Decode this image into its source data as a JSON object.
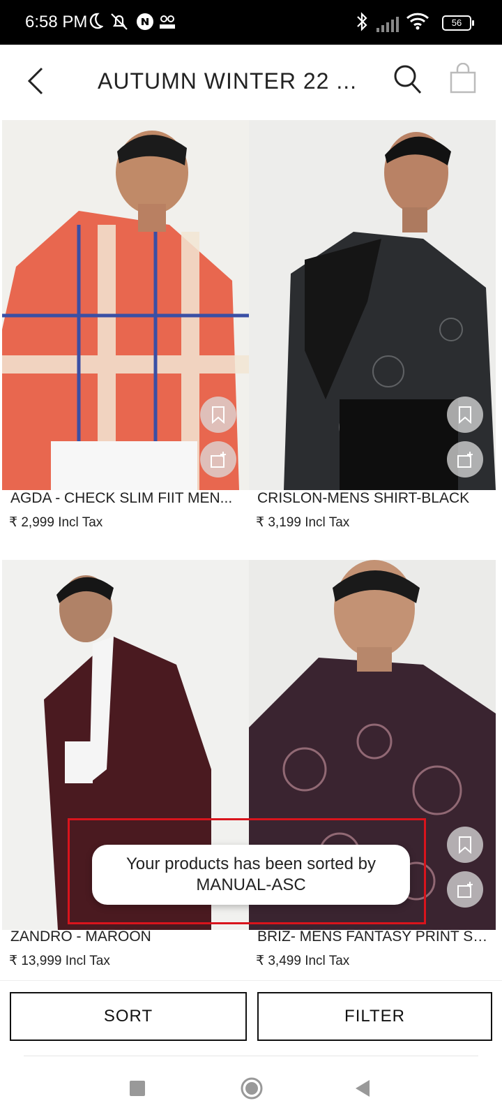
{
  "status_bar": {
    "time": "6:58 PM",
    "battery": "56"
  },
  "header": {
    "title": "AUTUMN WINTER 22 ...",
    "back_icon": "back-arrow-icon",
    "search_icon": "search-icon",
    "bag_icon": "shopping-bag-icon"
  },
  "products": [
    {
      "name": "AGDA - CHECK SLIM FIIT MEN...",
      "price": "₹ 2,999 Incl Tax"
    },
    {
      "name": "CRISLON-MENS SHIRT-BLACK",
      "price": "₹ 3,199 Incl Tax"
    },
    {
      "name": "ZANDRO - MAROON",
      "price": "₹ 13,999 Incl Tax"
    },
    {
      "name": "BRIZ- MENS FANTASY PRINT SH...",
      "price": "₹ 3,499 Incl Tax"
    }
  ],
  "actions": {
    "sort_label": "SORT",
    "filter_label": "FILTER"
  },
  "toast": {
    "line1": "Your products has been sorted by",
    "line2": "MANUAL-ASC"
  },
  "colors": {
    "highlight": "#d9141c",
    "shirt_check": "#e8674f",
    "shirt_black": "#2b2d30",
    "blazer_maroon": "#4a1a20",
    "shirt_print": "#3a2430"
  }
}
